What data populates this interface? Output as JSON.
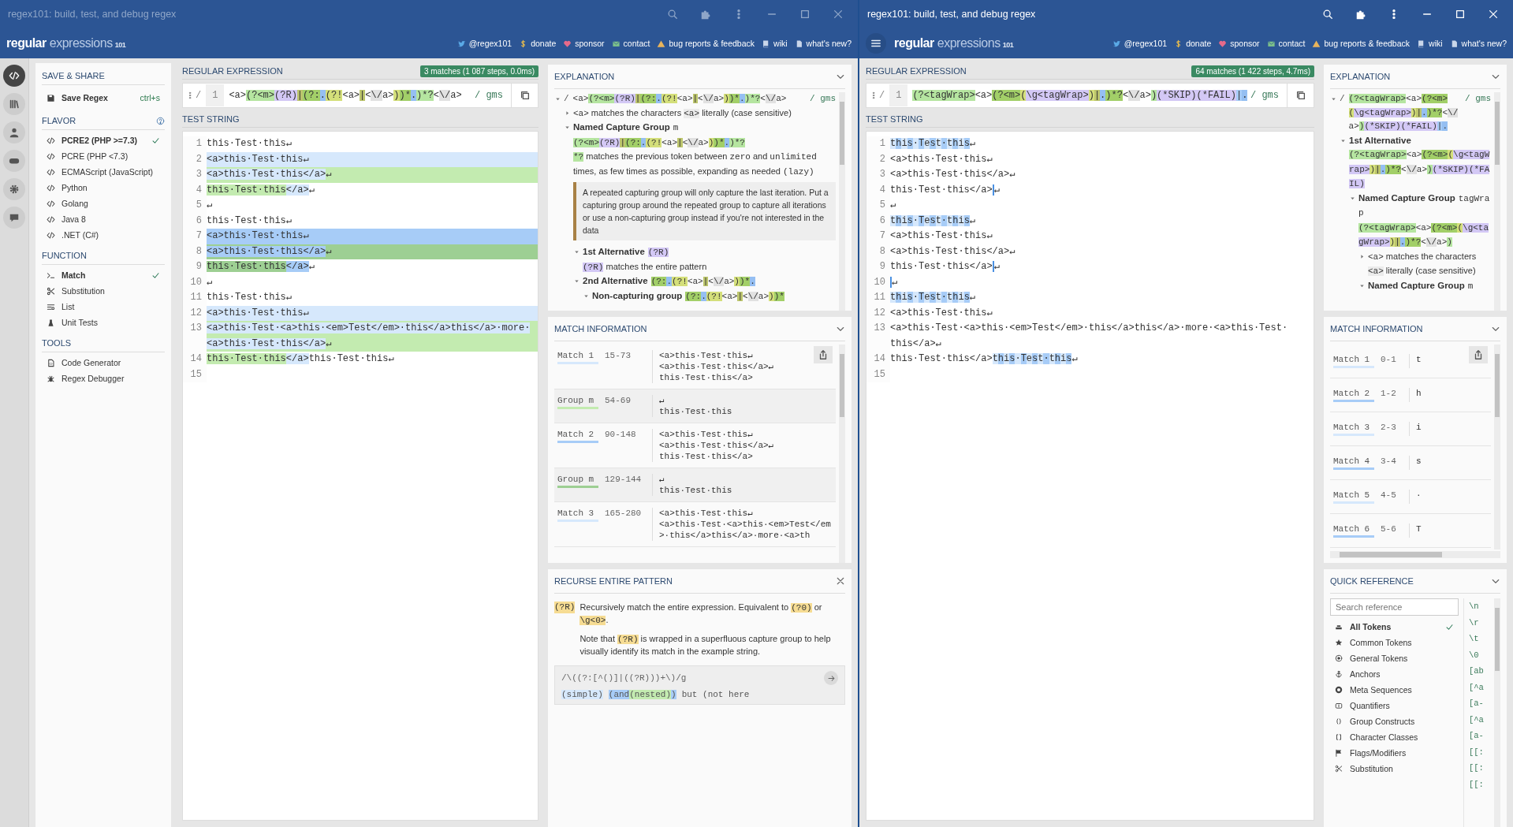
{
  "left_window": {
    "active": false,
    "title": "regex101: build, test, and debug regex",
    "logo": {
      "word1": "regular",
      "word2": "expressions",
      "number": "101"
    },
    "links": [
      "@regex101",
      "donate",
      "sponsor",
      "contact",
      "bug reports & feedback",
      "wiki",
      "what's new?"
    ],
    "sidebar": {
      "rail": [
        {
          "selected": true
        },
        {
          "selected": false
        },
        {
          "selected": false
        },
        {
          "selected": false
        },
        {
          "selected": false
        },
        {
          "selected": false
        }
      ],
      "save_share": {
        "title": "SAVE & SHARE",
        "label": "Save Regex",
        "shortcut": "ctrl+s"
      },
      "flavor": {
        "title": "FLAVOR",
        "items": [
          {
            "label": "PCRE2 (PHP >=7.3)",
            "selected": true
          },
          {
            "label": "PCRE (PHP <7.3)",
            "selected": false
          },
          {
            "label": "ECMAScript (JavaScript)",
            "selected": false
          },
          {
            "label": "Python",
            "selected": false
          },
          {
            "label": "Golang",
            "selected": false
          },
          {
            "label": "Java 8",
            "selected": false
          },
          {
            "label": ".NET (C#)",
            "selected": false
          }
        ]
      },
      "function": {
        "title": "FUNCTION",
        "items": [
          {
            "label": "Match",
            "selected": true
          },
          {
            "label": "Substitution",
            "selected": false
          },
          {
            "label": "List",
            "selected": false
          },
          {
            "label": "Unit Tests",
            "selected": false
          }
        ]
      },
      "tools": {
        "title": "TOOLS",
        "items": [
          "Code Generator",
          "Regex Debugger"
        ]
      }
    },
    "regex": {
      "title": "REGULAR EXPRESSION",
      "badge": "3 matches (1 087 steps, 0.0ms)",
      "delimiter": "/",
      "line": "1",
      "flags": "/ gms",
      "tokens": [
        {
          "text": "<a>",
          "kind": "code"
        },
        {
          "text": "(?<m>",
          "kind": "grp"
        },
        {
          "text": "(?R)",
          "kind": "rec"
        },
        {
          "text": "|",
          "kind": "alt"
        },
        {
          "text": "(?:",
          "kind": "grp2"
        },
        {
          "text": ".",
          "kind": "meta"
        },
        {
          "text": "(?!",
          "kind": "look"
        },
        {
          "text": "<a>",
          "kind": "code"
        },
        {
          "text": "|",
          "kind": "alt"
        },
        {
          "text": "<",
          "kind": "code"
        },
        {
          "text": "\\/",
          "kind": "esc"
        },
        {
          "text": "a>",
          "kind": "code"
        },
        {
          "text": ")",
          "kind": "look"
        },
        {
          "text": ")*",
          "kind": "grp2"
        },
        {
          "text": ".",
          "kind": "meta"
        },
        {
          "text": ")*?",
          "kind": "grp"
        },
        {
          "text": "<",
          "kind": "code"
        },
        {
          "text": "\\/",
          "kind": "esc"
        },
        {
          "text": "a>",
          "kind": "code"
        }
      ]
    },
    "test_string": {
      "title": "TEST STRING",
      "lines": [
        {
          "number": "1",
          "segments": [
            {
              "text": "this·Test·this↵",
              "kind": "code"
            }
          ]
        },
        {
          "number": "2",
          "segments": [
            {
              "text": "<a>this·Test·this↵",
              "kind": "m1"
            }
          ]
        },
        {
          "number": "3",
          "segments": [
            {
              "text": "<a>this·Test·this</a>",
              "kind": "m1"
            },
            {
              "text": "↵",
              "kind": "g1"
            }
          ]
        },
        {
          "number": "4",
          "segments": [
            {
              "text": "this·Test·this",
              "kind": "g1"
            },
            {
              "text": "</a>",
              "kind": "m1"
            },
            {
              "text": "↵",
              "kind": "code"
            }
          ]
        },
        {
          "number": "5",
          "segments": [
            {
              "text": "↵",
              "kind": "code"
            }
          ]
        },
        {
          "number": "6",
          "segments": [
            {
              "text": "this·Test·this↵",
              "kind": "code"
            }
          ]
        },
        {
          "number": "7",
          "segments": [
            {
              "text": "<a>this·Test·this↵",
              "kind": "m2"
            }
          ]
        },
        {
          "number": "8",
          "segments": [
            {
              "text": "<a>this·Test·this</a>",
              "kind": "m2"
            },
            {
              "text": "↵",
              "kind": "g2"
            }
          ]
        },
        {
          "number": "9",
          "segments": [
            {
              "text": "this·Test·this",
              "kind": "g2"
            },
            {
              "text": "</a>",
              "kind": "m2"
            },
            {
              "text": "↵",
              "kind": "code"
            }
          ]
        },
        {
          "number": "10",
          "segments": [
            {
              "text": "↵",
              "kind": "code"
            }
          ]
        },
        {
          "number": "11",
          "segments": [
            {
              "text": "this·Test·this↵",
              "kind": "code"
            }
          ]
        },
        {
          "number": "12",
          "segments": [
            {
              "text": "<a>this·Test·this↵",
              "kind": "m1"
            }
          ]
        },
        {
          "number": "13",
          "segments": [
            {
              "text": "<a>this·Test·<a>this·<em>Test</em>·this</a>this</a>·more·",
              "kind": "m1"
            },
            {
              "text": "<a>this·Test·this</a>",
              "kind": "m1"
            },
            {
              "text": "↵",
              "kind": "g1"
            }
          ]
        },
        {
          "number": "14",
          "segments": [
            {
              "text": "this·Test·this",
              "kind": "g1"
            },
            {
              "text": "</a>",
              "kind": "m1"
            },
            {
              "text": "this·Test·this↵",
              "kind": "code"
            }
          ]
        },
        {
          "number": "15"
        }
      ]
    },
    "explanation": {
      "title": "EXPLANATION",
      "tree": [
        {
          "expanded": true,
          "delimiter": "/",
          "flags": "/ gms",
          "tokens": [
            {
              "text": "<a>",
              "kind": "code"
            },
            {
              "text": "(?<m>",
              "kind": "grp"
            },
            {
              "text": "(?R)",
              "kind": "rec"
            },
            {
              "text": "|",
              "kind": "alt"
            },
            {
              "text": "(?:",
              "kind": "grp2"
            },
            {
              "text": ".",
              "kind": "meta"
            },
            {
              "text": "(?!",
              "kind": "look"
            },
            {
              "text": "<a>",
              "kind": "code"
            },
            {
              "text": "|",
              "kind": "alt"
            },
            {
              "text": "<",
              "kind": "code"
            },
            {
              "text": "\\/",
              "kind": "esc"
            },
            {
              "text": "a>",
              "kind": "code"
            },
            {
              "text": ")",
              "kind": "look"
            },
            {
              "text": ")*",
              "kind": "grp2"
            },
            {
              "text": ".",
              "kind": "meta"
            },
            {
              "text": ")*?",
              "kind": "grp"
            },
            {
              "text": "<",
              "kind": "code"
            },
            {
              "text": "\\/",
              "kind": "esc"
            },
            {
              "text": "a>",
              "kind": "code"
            }
          ],
          "children": [
            {
              "expanded": false,
              "title": [
                {
                  "text": "<a>",
                  "kind": "code"
                },
                {
                  "text": " matches the characters ",
                  "kind": "none"
                },
                {
                  "text": "<a>",
                  "kind": "chip"
                },
                {
                  "text": " literally (case sensitive)",
                  "kind": "none"
                }
              ]
            },
            {
              "expanded": true,
              "title": [
                {
                  "text": "Named Capture Group",
                  "kind": "bold"
                },
                {
                  "text": "m",
                  "kind": "code"
                }
              ],
              "body": [
                [
                  {
                    "text": "(?<m>",
                    "kind": "grp"
                  },
                  {
                    "text": "(?R)",
                    "kind": "rec"
                  },
                  {
                    "text": "|",
                    "kind": "alt"
                  },
                  {
                    "text": "(?:",
                    "kind": "grp2"
                  },
                  {
                    "text": ".",
                    "kind": "meta"
                  },
                  {
                    "text": "(?!",
                    "kind": "look"
                  },
                  {
                    "text": "<a>",
                    "kind": "code"
                  },
                  {
                    "text": "|",
                    "kind": "alt"
                  },
                  {
                    "text": "<",
                    "kind": "code"
                  },
                  {
                    "text": "\\/",
                    "kind": "esc"
                  },
                  {
                    "text": "a>",
                    "kind": "code"
                  },
                  {
                    "text": ")",
                    "kind": "look"
                  },
                  {
                    "text": ")*",
                    "kind": "grp2"
                  },
                  {
                    "text": ".",
                    "kind": "meta"
                  },
                  {
                    "text": ")*?",
                    "kind": "grp"
                  }
                ],
                [
                  {
                    "text": "*?",
                    "kind": "grp"
                  },
                  {
                    "text": " matches the previous token between ",
                    "kind": "none"
                  },
                  {
                    "text": "zero",
                    "kind": "code"
                  },
                  {
                    "text": " and ",
                    "kind": "none"
                  },
                  {
                    "text": "unlimited",
                    "kind": "code"
                  },
                  {
                    "text": " times, as few times as possible, expanding as needed ",
                    "kind": "none"
                  },
                  {
                    "text": "(lazy)",
                    "kind": "code"
                  }
                ]
              ],
              "note": "A repeated capturing group will only capture the last iteration. Put a capturing group around the repeated group to capture all iterations or use a non-capturing group instead if you're not interested in the data",
              "children": [
                {
                  "expanded": true,
                  "title": [
                    {
                      "text": "1st Alternative",
                      "kind": "bold"
                    },
                    {
                      "text": "(?R)",
                      "kind": "rec"
                    }
                  ],
                  "body": [
                    [
                      {
                        "text": "(?R)",
                        "kind": "rec"
                      },
                      {
                        "text": " matches the entire pattern",
                        "kind": "none"
                      }
                    ]
                  ]
                },
                {
                  "expanded": true,
                  "title": [
                    {
                      "text": "2nd Alternative",
                      "kind": "bold"
                    },
                    {
                      "text": "(?:",
                      "kind": "grp2"
                    },
                    {
                      "text": ".",
                      "kind": "meta"
                    },
                    {
                      "text": "(?!",
                      "kind": "look"
                    },
                    {
                      "text": "<a>",
                      "kind": "code"
                    },
                    {
                      "text": "|",
                      "kind": "alt"
                    },
                    {
                      "text": "<",
                      "kind": "code"
                    },
                    {
                      "text": "\\/",
                      "kind": "esc"
                    },
                    {
                      "text": "a>",
                      "kind": "code"
                    },
                    {
                      "text": ")",
                      "kind": "look"
                    },
                    {
                      "text": ")*",
                      "kind": "grp2"
                    },
                    {
                      "text": ".",
                      "kind": "meta"
                    }
                  ],
                  "children": [
                    {
                      "expanded": true,
                      "title": [
                        {
                          "text": "Non-capturing group",
                          "kind": "bold"
                        },
                        {
                          "text": "(?:",
                          "kind": "grp2"
                        },
                        {
                          "text": ".",
                          "kind": "meta"
                        },
                        {
                          "text": "(?!",
                          "kind": "look"
                        },
                        {
                          "text": "<a>",
                          "kind": "code"
                        },
                        {
                          "text": "|",
                          "kind": "alt"
                        },
                        {
                          "text": "<",
                          "kind": "code"
                        },
                        {
                          "text": "\\/",
                          "kind": "esc"
                        },
                        {
                          "text": "a>",
                          "kind": "code"
                        },
                        {
                          "text": ")",
                          "kind": "look"
                        },
                        {
                          "text": ")*",
                          "kind": "grp2"
                        }
                      ]
                    }
                  ]
                }
              ]
            }
          ]
        }
      ]
    },
    "match_information": {
      "title": "MATCH INFORMATION",
      "items": [
        {
          "label": "Match 1",
          "range": "15-73",
          "kind": "m1",
          "lines": [
            "<a>this·Test·this↵",
            "<a>this·Test·this</a>↵",
            "this·Test·this</a>"
          ]
        },
        {
          "label": "Group m",
          "range": "54-69",
          "kind": "g1",
          "lines": [
            "↵",
            "this·Test·this"
          ]
        },
        {
          "label": "Match 2",
          "range": "90-148",
          "kind": "m2",
          "lines": [
            "<a>this·Test·this↵",
            "<a>this·Test·this</a>↵",
            "this·Test·this</a>"
          ]
        },
        {
          "label": "Group m",
          "range": "129-144",
          "kind": "g2",
          "lines": [
            "↵",
            "this·Test·this"
          ]
        },
        {
          "label": "Match 3",
          "range": "165-280",
          "kind": "m1",
          "lines": [
            "<a>this·Test·this↵",
            "<a>this·Test·<a>this·<em>Test</em>·this</a>this</a>·more·<a>th"
          ]
        }
      ]
    },
    "recurse": {
      "title": "RECURSE ENTIRE PATTERN",
      "token": "(?R)",
      "paragraphs": [
        [
          {
            "text": "Recursively match the entire expression. Equivalent to ",
            "kind": "none"
          },
          {
            "text": "(?0)",
            "kind": "yel"
          },
          {
            "text": " or ",
            "kind": "none"
          },
          {
            "text": "\\g<0>",
            "kind": "yel"
          },
          {
            "text": ".",
            "kind": "none"
          }
        ],
        [
          {
            "text": "Note that ",
            "kind": "none"
          },
          {
            "text": "(?R)",
            "kind": "yel"
          },
          {
            "text": " is wrapped in a superfluous capture group to help visually identify its match in the example string.",
            "kind": "none"
          }
        ]
      ],
      "example_regex": "/\\((?:[^()]|((?R)))+\\)/g",
      "example_text": [
        [
          {
            "text": "(simple)",
            "kind": "m1"
          }
        ],
        [
          {
            "text": "(and",
            "kind": "m2"
          },
          {
            "text": "(nested)",
            "kind": "g1"
          },
          {
            "text": ")",
            "kind": "m2"
          }
        ],
        [
          {
            "text": "but (not here",
            "kind": "code"
          }
        ]
      ]
    }
  },
  "right_window": {
    "active": true,
    "title": "regex101: build, test, and debug regex",
    "logo": {
      "word1": "regular",
      "word2": "expressions",
      "number": "101"
    },
    "links": [
      "@regex101",
      "donate",
      "sponsor",
      "contact",
      "bug reports & feedback",
      "wiki",
      "what's new?"
    ],
    "regex": {
      "title": "REGULAR EXPRESSION",
      "badge": "64 matches (1 422 steps, 4.7ms)",
      "delimiter": "/",
      "line": "1",
      "flags": "/ gms",
      "tokens": [
        {
          "text": "(?<tagWrap>",
          "kind": "grp"
        },
        {
          "text": "<a>",
          "kind": "code"
        },
        {
          "text": "(?<m>",
          "kind": "grp2"
        },
        {
          "text": "(",
          "kind": "look"
        },
        {
          "text": "\\g<tagWrap>",
          "kind": "rec"
        },
        {
          "text": ")",
          "kind": "look"
        },
        {
          "text": "|",
          "kind": "alt"
        },
        {
          "text": ".",
          "kind": "meta"
        },
        {
          "text": ")*?",
          "kind": "grp2"
        },
        {
          "text": "<",
          "kind": "code"
        },
        {
          "text": "\\/",
          "kind": "esc"
        },
        {
          "text": "a>",
          "kind": "code"
        },
        {
          "text": ")",
          "kind": "grp"
        },
        {
          "text": "(*SKIP)(*FAIL)",
          "kind": "rec"
        },
        {
          "text": "|",
          "kind": "m2"
        },
        {
          "text": ".",
          "kind": "meta"
        }
      ]
    },
    "test_string": {
      "title": "TEST STRING",
      "lines": [
        {
          "number": "1",
          "segments": [
            {
              "text": "this·Test·this",
              "kind": "alt_chars"
            },
            {
              "text": "↵",
              "kind": "code"
            }
          ]
        },
        {
          "number": "2",
          "segments": [
            {
              "text": "<a>this·Test·this↵",
              "kind": "code"
            }
          ]
        },
        {
          "number": "3",
          "segments": [
            {
              "text": "<a>this·Test·this</a>↵",
              "kind": "code"
            }
          ]
        },
        {
          "number": "4",
          "segments": [
            {
              "text": "this·Test·this</a>",
              "kind": "code"
            },
            {
              "text": "↵",
              "kind": "edge"
            }
          ]
        },
        {
          "number": "5",
          "segments": [
            {
              "text": "↵",
              "kind": "code"
            }
          ]
        },
        {
          "number": "6",
          "segments": [
            {
              "text": "this·Test·this",
              "kind": "alt_chars"
            },
            {
              "text": "↵",
              "kind": "code"
            }
          ]
        },
        {
          "number": "7",
          "segments": [
            {
              "text": "<a>this·Test·this↵",
              "kind": "code"
            }
          ]
        },
        {
          "number": "8",
          "segments": [
            {
              "text": "<a>this·Test·this</a>↵",
              "kind": "code"
            }
          ]
        },
        {
          "number": "9",
          "segments": [
            {
              "text": "this·Test·this</a>",
              "kind": "code"
            },
            {
              "text": "↵",
              "kind": "edge"
            }
          ]
        },
        {
          "number": "10",
          "segments": [
            {
              "text": "↵",
              "kind": "edge"
            }
          ]
        },
        {
          "number": "11",
          "segments": [
            {
              "text": "this·Test·this",
              "kind": "alt_chars"
            },
            {
              "text": "↵",
              "kind": "code"
            }
          ]
        },
        {
          "number": "12",
          "segments": [
            {
              "text": "<a>this·Test·this↵",
              "kind": "code"
            }
          ]
        },
        {
          "number": "13",
          "segments": [
            {
              "text": "<a>this·Test·<a>this·<em>Test</em>·this</a>this</a>·more·<a>this·Test·",
              "kind": "code"
            },
            {
              "text": "this</a>↵",
              "kind": "code"
            }
          ]
        },
        {
          "number": "14",
          "segments": [
            {
              "text": "this·Test·this</a>",
              "kind": "code"
            },
            {
              "text": "this·Test·this",
              "kind": "alt_chars"
            },
            {
              "text": "↵",
              "kind": "code"
            }
          ]
        },
        {
          "number": "15"
        }
      ]
    },
    "explanation": {
      "title": "EXPLANATION",
      "tree": [
        {
          "expanded": true,
          "delimiter": "/",
          "flags": "/ gms",
          "tokens": [
            {
              "text": "(?<tagWrap>",
              "kind": "grp"
            },
            {
              "text": "<a>",
              "kind": "code"
            },
            {
              "text": "(?<m>",
              "kind": "grp2"
            },
            {
              "text": "(",
              "kind": "look"
            },
            {
              "text": "\\g<tagWrap>",
              "kind": "rec"
            },
            {
              "text": ")",
              "kind": "look"
            },
            {
              "text": "|",
              "kind": "alt"
            },
            {
              "text": ".",
              "kind": "meta"
            },
            {
              "text": ")*?",
              "kind": "grp2"
            },
            {
              "text": "<",
              "kind": "code"
            },
            {
              "text": "\\/",
              "kind": "esc"
            },
            {
              "text": "a>",
              "kind": "code"
            },
            {
              "text": ")",
              "kind": "grp"
            },
            {
              "text": "(*SKIP)(*FAIL)",
              "kind": "rec"
            },
            {
              "text": "|",
              "kind": "m2"
            },
            {
              "text": ".",
              "kind": "meta"
            }
          ],
          "children": [
            {
              "expanded": true,
              "title": [
                {
                  "text": "1st Alternative",
                  "kind": "bold"
                }
              ],
              "body": [
                [
                  {
                    "text": "(?<tagWrap>",
                    "kind": "grp"
                  },
                  {
                    "text": "<a>",
                    "kind": "code"
                  },
                  {
                    "text": "(?<m>",
                    "kind": "grp2"
                  },
                  {
                    "text": "(",
                    "kind": "look"
                  },
                  {
                    "text": "\\g<tagWrap>",
                    "kind": "rec"
                  },
                  {
                    "text": ")",
                    "kind": "look"
                  },
                  {
                    "text": "|",
                    "kind": "alt"
                  },
                  {
                    "text": ".",
                    "kind": "meta"
                  },
                  {
                    "text": ")*?",
                    "kind": "grp2"
                  },
                  {
                    "text": "<",
                    "kind": "code"
                  },
                  {
                    "text": "\\/",
                    "kind": "esc"
                  },
                  {
                    "text": "a>",
                    "kind": "code"
                  },
                  {
                    "text": ")",
                    "kind": "grp"
                  },
                  {
                    "text": "(*SKIP)(*FAIL)",
                    "kind": "rec"
                  }
                ]
              ],
              "children": [
                {
                  "expanded": true,
                  "title": [
                    {
                      "text": "Named Capture Group",
                      "kind": "bold"
                    },
                    {
                      "text": "tagWrap",
                      "kind": "code"
                    }
                  ],
                  "body": [
                    [
                      {
                        "text": "(?<tagWrap>",
                        "kind": "grp"
                      },
                      {
                        "text": "<a>",
                        "kind": "code"
                      },
                      {
                        "text": "(?<m>",
                        "kind": "grp2"
                      },
                      {
                        "text": "(",
                        "kind": "look"
                      },
                      {
                        "text": "\\g<tagWrap>",
                        "kind": "rec"
                      },
                      {
                        "text": ")",
                        "kind": "look"
                      },
                      {
                        "text": "|",
                        "kind": "alt"
                      },
                      {
                        "text": ".",
                        "kind": "meta"
                      },
                      {
                        "text": ")*?",
                        "kind": "grp2"
                      },
                      {
                        "text": "<",
                        "kind": "code"
                      },
                      {
                        "text": "\\/",
                        "kind": "esc"
                      },
                      {
                        "text": "a>",
                        "kind": "code"
                      },
                      {
                        "text": ")",
                        "kind": "grp"
                      }
                    ]
                  ],
                  "children": [
                    {
                      "expanded": false,
                      "title": [
                        {
                          "text": "<a>",
                          "kind": "code"
                        },
                        {
                          "text": " matches the characters ",
                          "kind": "none"
                        },
                        {
                          "text": "<a>",
                          "kind": "chip"
                        },
                        {
                          "text": " literally (case sensitive)",
                          "kind": "none"
                        }
                      ]
                    },
                    {
                      "expanded": true,
                      "title": [
                        {
                          "text": "Named Capture Group",
                          "kind": "bold"
                        },
                        {
                          "text": "m",
                          "kind": "code"
                        }
                      ]
                    }
                  ]
                }
              ]
            }
          ]
        }
      ]
    },
    "match_information": {
      "title": "MATCH INFORMATION",
      "items": [
        {
          "label": "Match 1",
          "range": "0-1",
          "kind": "m1",
          "lines": [
            "t"
          ]
        },
        {
          "label": "Match 2",
          "range": "1-2",
          "kind": "m2",
          "lines": [
            "h"
          ]
        },
        {
          "label": "Match 3",
          "range": "2-3",
          "kind": "m1",
          "lines": [
            "i"
          ]
        },
        {
          "label": "Match 4",
          "range": "3-4",
          "kind": "m2",
          "lines": [
            "s"
          ]
        },
        {
          "label": "Match 5",
          "range": "4-5",
          "kind": "m1",
          "lines": [
            "·"
          ]
        },
        {
          "label": "Match 6",
          "range": "5-6",
          "kind": "m2",
          "lines": [
            "T"
          ]
        }
      ]
    },
    "quick_reference": {
      "title": "QUICK REFERENCE",
      "placeholder": "Search reference",
      "categories": [
        {
          "label": "All Tokens",
          "selected": true
        },
        {
          "label": "Common Tokens",
          "selected": false
        },
        {
          "label": "General Tokens",
          "selected": false
        },
        {
          "label": "Anchors",
          "selected": false
        },
        {
          "label": "Meta Sequences",
          "selected": false
        },
        {
          "label": "Quantifiers",
          "selected": false
        },
        {
          "label": "Group Constructs",
          "selected": false
        },
        {
          "label": "Character Classes",
          "selected": false
        },
        {
          "label": "Flags/Modifiers",
          "selected": false
        },
        {
          "label": "Substitution",
          "selected": false
        }
      ],
      "tokens": [
        "\\n",
        "\\r",
        "\\t",
        "\\0",
        "[ab",
        "[^a",
        "[a-",
        "[^a",
        "[a-",
        "[[:",
        "[[:",
        "[[:"
      ]
    }
  }
}
